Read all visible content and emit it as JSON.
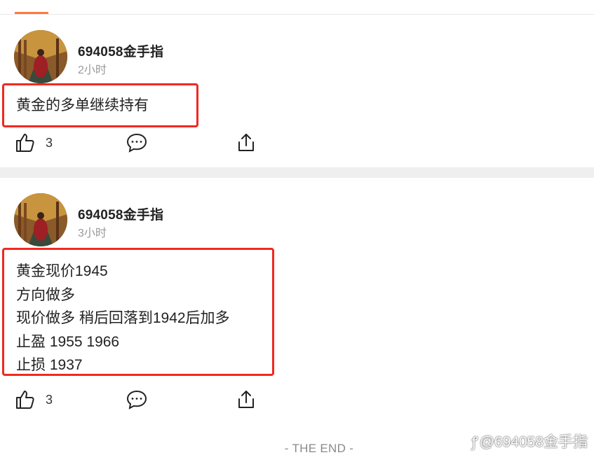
{
  "posts": [
    {
      "username": "694058金手指",
      "time": "2小时",
      "content_lines": [
        "黄金的多单继续持有"
      ],
      "like_count": "3"
    },
    {
      "username": "694058金手指",
      "time": "3小时",
      "content_lines": [
        "黄金现价1945",
        "方向做多",
        "现价做多 稍后回落到1942后加多",
        "止盈 1955 1966",
        "止损 1937"
      ],
      "like_count": "3"
    }
  ],
  "footer": {
    "end_text": "- THE END -",
    "watermark": "@694058金手指"
  },
  "colors": {
    "highlight_border": "#f2281f",
    "accent": "#ff7a3d",
    "timestamp": "#9a9a9a"
  },
  "icons": [
    "thumbs-up-icon",
    "comment-icon",
    "share-icon",
    "weibo-logo-icon"
  ]
}
